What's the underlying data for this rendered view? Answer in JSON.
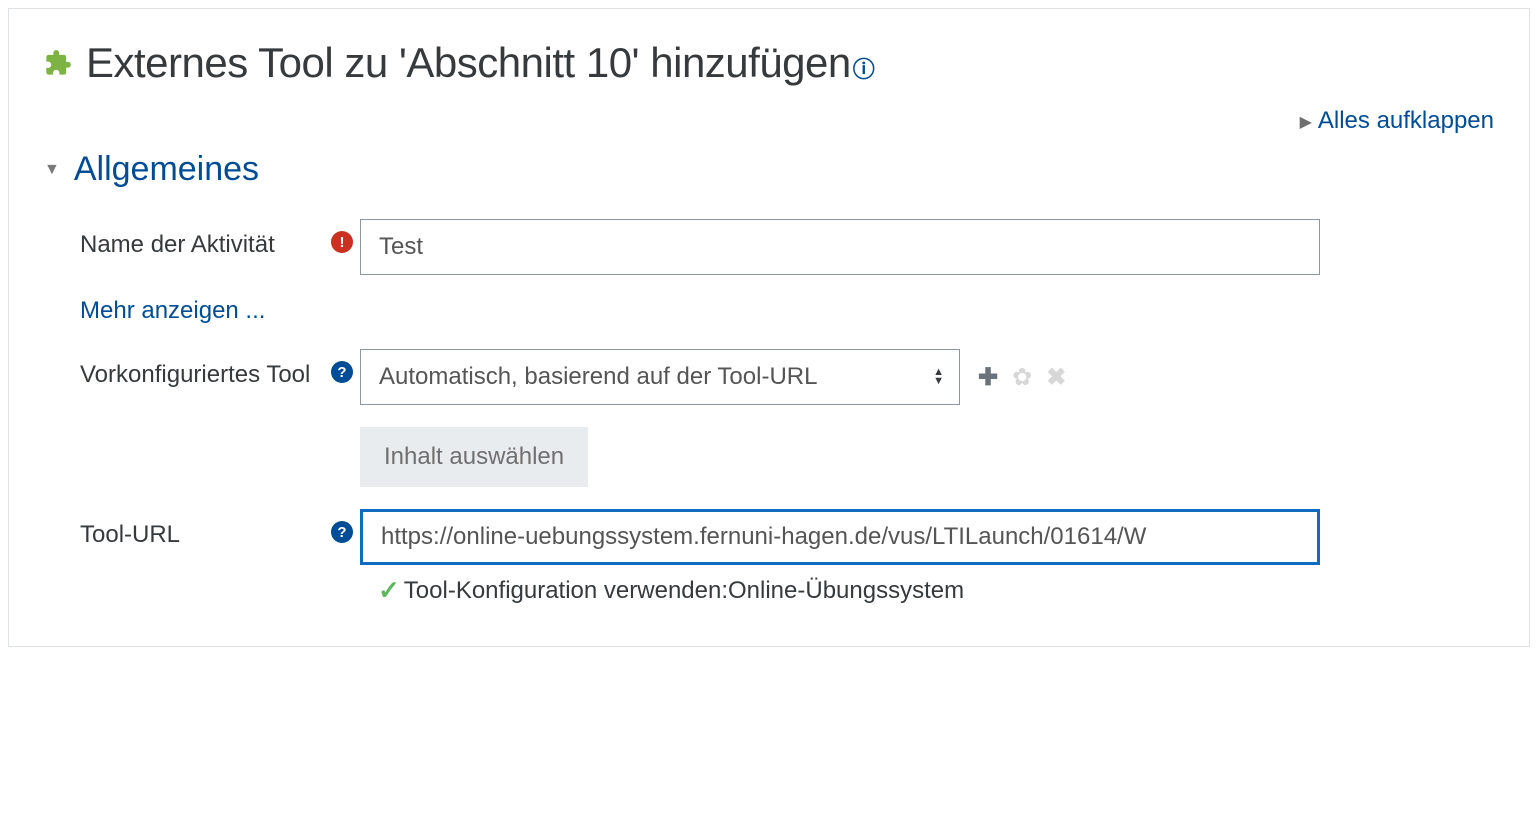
{
  "page": {
    "title": "Externes Tool zu 'Abschnitt 10' hinzufügen",
    "expand_all": "Alles aufklappen"
  },
  "section": {
    "title": "Allgemeines"
  },
  "fields": {
    "activity_name": {
      "label": "Name der Aktivität",
      "value": "Test"
    },
    "show_more": "Mehr anzeigen ...",
    "preconfigured_tool": {
      "label": "Vorkonfiguriertes Tool",
      "selected": "Automatisch, basierend auf der Tool-URL"
    },
    "select_content_button": "Inhalt auswählen",
    "tool_url": {
      "label": "Tool-URL",
      "value": "https://online-uebungssystem.fernuni-hagen.de/vus/LTILaunch/01614/W",
      "hint": "Tool-Konfiguration verwenden:Online-Übungssystem"
    }
  }
}
